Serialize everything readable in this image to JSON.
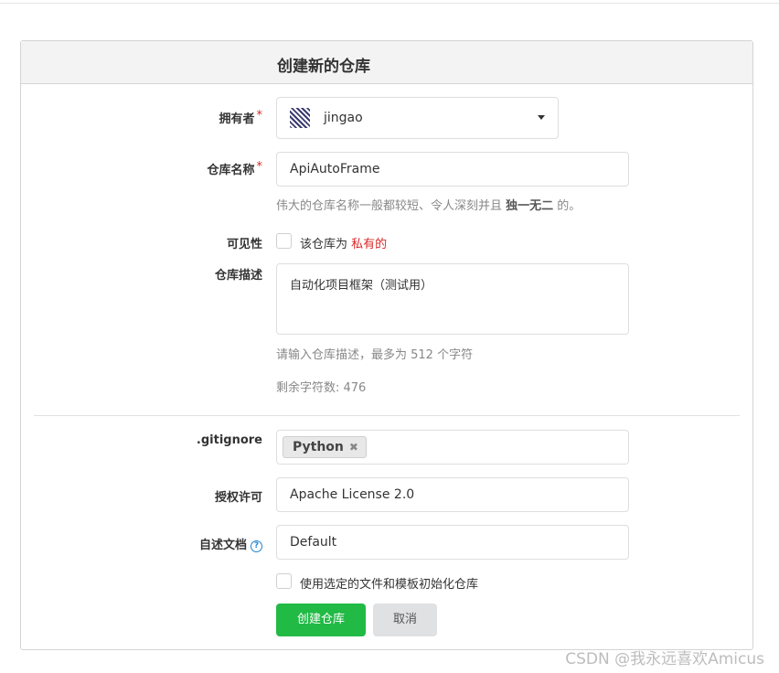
{
  "form": {
    "title": "创建新的仓库",
    "owner": {
      "label": "拥有者",
      "required_mark": "*",
      "value": "jingao"
    },
    "repo_name": {
      "label": "仓库名称",
      "required_mark": "*",
      "value": "ApiAutoFrame",
      "help_prefix": "伟大的仓库名称一般都较短、令人深刻并且 ",
      "help_bold1": "独一无二",
      "help_suffix": " 的。"
    },
    "visibility": {
      "label": "可见性",
      "checkbox_text": "该仓库为",
      "private_text": "私有的",
      "checked": false
    },
    "description": {
      "label": "仓库描述",
      "value": "自动化项目框架（测试用）",
      "help": "请输入仓库描述，最多为 512 个字符",
      "remaining": "剩余字符数: 476"
    },
    "gitignore": {
      "label": ".gitignore",
      "tag": "Python",
      "tag_remove": "✖"
    },
    "license": {
      "label": "授权许可",
      "value": "Apache License 2.0"
    },
    "readme": {
      "label": "自述文档",
      "help_icon": "?",
      "value": "Default"
    },
    "auto_init": {
      "text": "使用选定的文件和模板初始化仓库",
      "checked": false
    },
    "buttons": {
      "create": "创建仓库",
      "cancel": "取消"
    }
  },
  "watermark": "CSDN @我永远喜欢Amicus",
  "colors": {
    "primary_green": "#21ba45",
    "required_red": "#db2828",
    "help_blue": "#2185d0"
  }
}
